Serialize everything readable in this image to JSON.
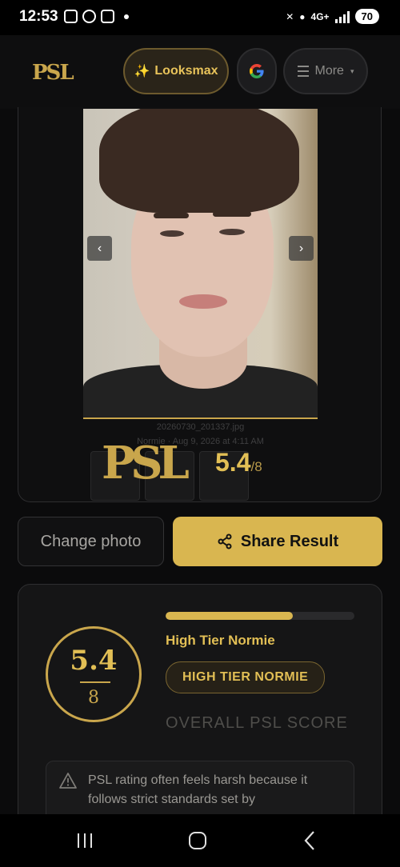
{
  "status_bar": {
    "time": "12:53",
    "network": "4G+",
    "battery": "70"
  },
  "nav": {
    "logo": "PSL",
    "looksmax_label": "Looksmax",
    "looksmax_icon": "sparkles-icon",
    "google_label": "G",
    "more_label": "More"
  },
  "photo": {
    "filename": "20260730_201337.jpg",
    "info": "Normie · Aug 9, 2026 at 4:11 AM",
    "watermark_logo": "PSL",
    "watermark_score": "5.4",
    "watermark_max": "/8"
  },
  "actions": {
    "change_label": "Change photo",
    "share_label": "Share Result"
  },
  "result": {
    "score": "5.4",
    "max": "8",
    "progress_fraction": 0.675,
    "tier": "High Tier Normie",
    "tier_badge": "HIGH TIER NORMIE",
    "overall_label": "OVERALL PSL SCORE",
    "warning": "PSL rating often feels harsh because it follows strict standards set by"
  },
  "colors": {
    "accent": "#d9b650",
    "background": "#0b0b0c"
  }
}
